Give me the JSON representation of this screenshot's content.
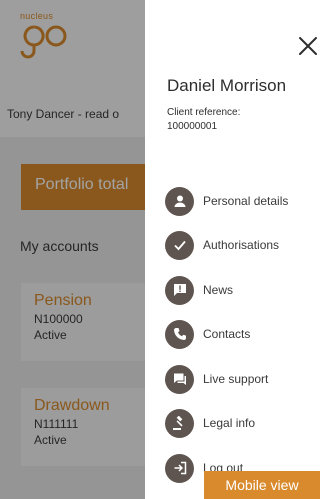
{
  "app": {
    "logo_small": "nucleus",
    "user_line": "Tony Dancer - read o",
    "portfolio_label": "Portfolio total",
    "accounts_heading": "My accounts",
    "accounts": [
      {
        "name": "Pension",
        "number": "N100000",
        "status": "Active"
      },
      {
        "name": "Drawdown",
        "number": "N111111",
        "status": "Active"
      }
    ]
  },
  "drawer": {
    "user_name": "Daniel Morrison",
    "client_ref_label": "Client reference:",
    "client_ref_value": "100000001",
    "menu": [
      {
        "label": "Personal details",
        "icon": "person-icon"
      },
      {
        "label": "Authorisations",
        "icon": "check-icon"
      },
      {
        "label": "News",
        "icon": "alert-message-icon"
      },
      {
        "label": "Contacts",
        "icon": "phone-icon"
      },
      {
        "label": "Live support",
        "icon": "chat-icon"
      },
      {
        "label": "Legal info",
        "icon": "gavel-icon"
      },
      {
        "label": "Log out",
        "icon": "logout-icon"
      }
    ]
  },
  "badge": "Mobile view",
  "colors": {
    "accent": "#d88a2c",
    "icon_bg": "#5f5550"
  }
}
